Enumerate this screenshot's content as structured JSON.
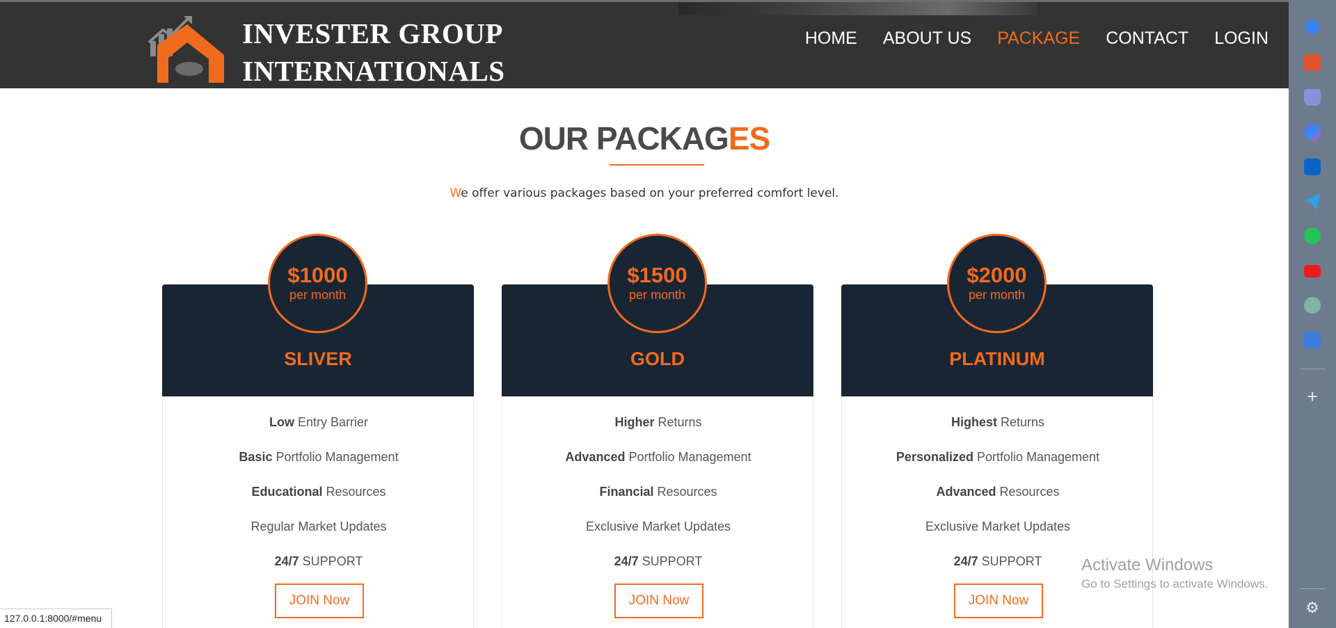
{
  "header": {
    "logo_line1": "INVESTER GROUP",
    "logo_line2": "INTERNATIONALS",
    "nav": [
      {
        "label": "HOME",
        "active": false
      },
      {
        "label": "ABOUT US",
        "active": false
      },
      {
        "label": "PACKAGE",
        "active": true
      },
      {
        "label": "CONTACT",
        "active": false
      },
      {
        "label": "LOGIN",
        "active": false
      }
    ]
  },
  "section": {
    "title_main": "OUR PACKAG",
    "title_accent": "ES",
    "subtitle_first": "W",
    "subtitle_rest": "e offer various packages based on your preferred comfort level."
  },
  "packages": [
    {
      "price": "$1000",
      "period": "per month",
      "name": "SLIVER",
      "features": [
        {
          "bold": "Low",
          "text": " Entry Barrier"
        },
        {
          "bold": "Basic",
          "text": " Portfolio Management"
        },
        {
          "bold": "Educational",
          "text": " Resources"
        },
        {
          "bold": "",
          "text": "Regular Market Updates"
        },
        {
          "bold": "24/7",
          "text": " SUPPORT"
        }
      ],
      "button": "JOIN Now"
    },
    {
      "price": "$1500",
      "period": "per month",
      "name": "GOLD",
      "features": [
        {
          "bold": "Higher",
          "text": " Returns"
        },
        {
          "bold": "Advanced",
          "text": " Portfolio Management"
        },
        {
          "bold": "Financial",
          "text": " Resources"
        },
        {
          "bold": "",
          "text": "Exclusive Market Updates"
        },
        {
          "bold": "24/7",
          "text": " SUPPORT"
        }
      ],
      "button": "JOIN Now"
    },
    {
      "price": "$2000",
      "period": "per month",
      "name": "PLATINUM",
      "features": [
        {
          "bold": "Highest",
          "text": " Returns"
        },
        {
          "bold": "Personalized",
          "text": " Portfolio Management"
        },
        {
          "bold": "Advanced",
          "text": " Resources"
        },
        {
          "bold": "",
          "text": "Exclusive Market Updates"
        },
        {
          "bold": "24/7",
          "text": " SUPPORT"
        }
      ],
      "button": "JOIN Now"
    }
  ],
  "sidebar": {
    "icons": [
      "tag-icon",
      "toolbox-icon",
      "chess-icon",
      "copilot-icon",
      "outlook-icon",
      "send-icon",
      "whatsapp-icon",
      "youtube-icon",
      "chatgpt-icon",
      "translate-icon"
    ],
    "plus_glyph": "+",
    "settings_glyph": "⚙"
  },
  "watermark": {
    "line1": "Activate Windows",
    "line2": "Go to Settings to activate Windows."
  },
  "status_url": "127.0.0.1:8000/#menu",
  "colors": {
    "accent": "#f26b1d",
    "header_bg": "#333333",
    "card_head_bg": "#1a2533",
    "sidebar_bg": "#6e7b8c"
  }
}
